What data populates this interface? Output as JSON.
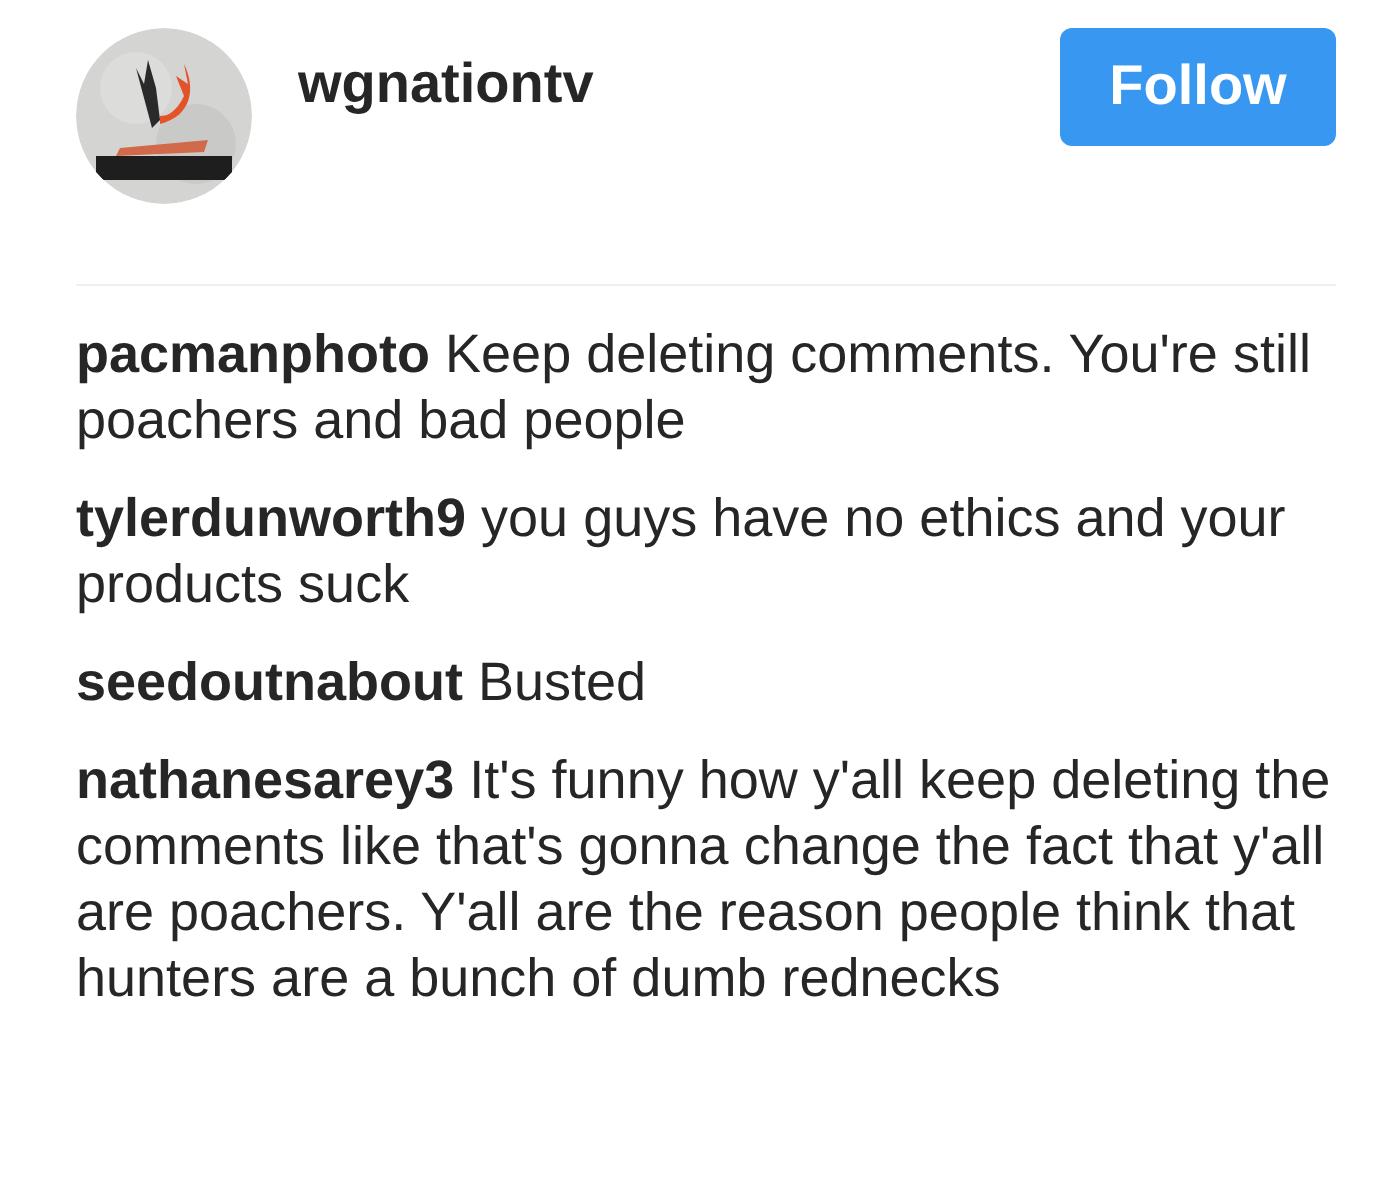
{
  "header": {
    "username": "wgnationtv",
    "follow_button": "Follow"
  },
  "comments": [
    {
      "username": "pacmanphoto",
      "text": "Keep deleting comments. You're still poachers and bad people"
    },
    {
      "username": "tylerdunworth9",
      "text": "you guys have no ethics and your products suck"
    },
    {
      "username": "seedoutnabout",
      "text": "Busted"
    },
    {
      "username": "nathanesarey3",
      "text": "It's funny how y'all keep deleting the comments like that's gonna change the fact that y'all are poachers. Y'all are the reason people think that hunters are a bunch of dumb rednecks"
    }
  ]
}
